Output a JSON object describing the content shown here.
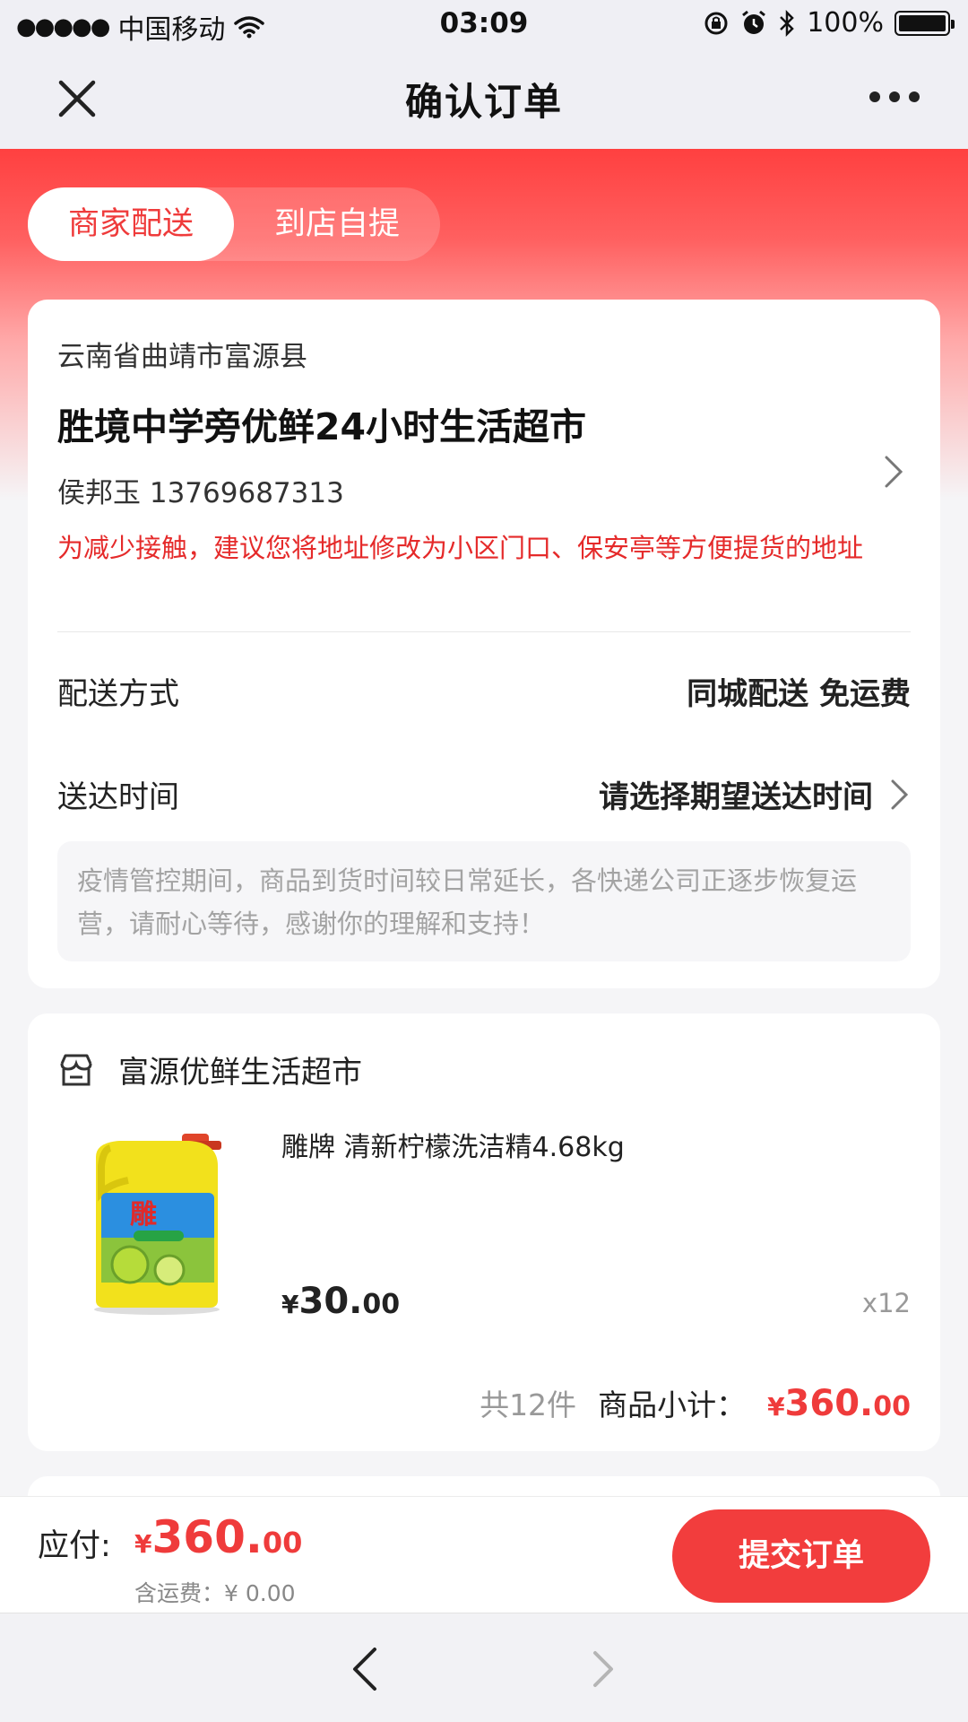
{
  "status_bar": {
    "signal_dots": "●●●●●",
    "carrier": "中国移动",
    "time": "03:09",
    "battery": "100%"
  },
  "nav": {
    "title": "确认订单"
  },
  "delivery_tabs": {
    "active": "商家配送",
    "inactive": "到店自提"
  },
  "address": {
    "region": "云南省曲靖市富源县",
    "name": "胜境中学旁优鲜24小时生活超市",
    "contact": "侯邦玉 13769687313",
    "tip": "为减少接触，建议您将地址修改为小区门口、保安亭等方便提货的地址"
  },
  "shipping": {
    "method_label": "配送方式",
    "method_value": "同城配送 免运费",
    "time_label": "送达时间",
    "time_value": "请选择期望送达时间",
    "notice": "疫情管控期间，商品到货时间较日常延长，各快递公司正逐步恢复运营，请耐心等待，感谢你的理解和支持！"
  },
  "store": {
    "name": "富源优鲜生活超市",
    "product": {
      "title": "雕牌 清新柠檬洗洁精4.68kg",
      "price_symbol": "¥",
      "price_int": "30.",
      "price_dec": "00",
      "quantity": "x12"
    },
    "summary": {
      "count": "共12件",
      "label": "商品小计：",
      "symbol": "¥",
      "int": "360.",
      "dec": "00"
    }
  },
  "pay_bar": {
    "label": "应付:",
    "symbol": "¥",
    "int": "360.",
    "dec": "00",
    "fee": "含运费：¥ 0.00",
    "submit": "提交订单"
  },
  "colors": {
    "accent": "#ef3b3b",
    "nav_bg": "#efeff4",
    "tip_red": "#e52a2a"
  }
}
